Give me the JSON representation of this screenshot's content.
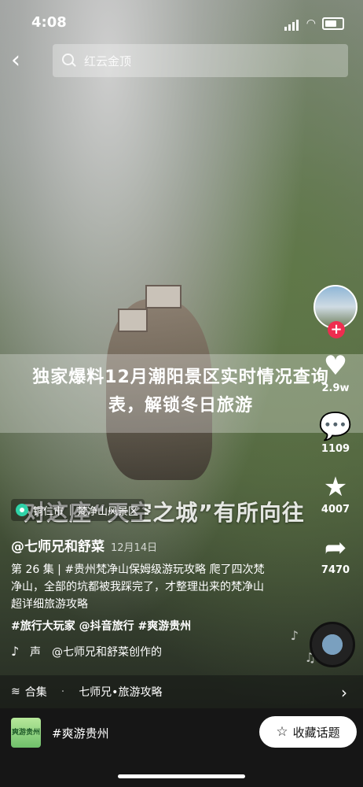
{
  "status": {
    "time": "4:08"
  },
  "search": {
    "query": "红云金顶"
  },
  "banner": {
    "text": "独家爆料12月潮阳景区实时情况查询表，解锁冬日旅游"
  },
  "actions": {
    "likes": "2.9w",
    "comments": "1109",
    "stars": "4007",
    "shares": "7470"
  },
  "location": {
    "city": "铜仁市",
    "spot": "梵净山风景区"
  },
  "overlay": {
    "text": "对这座“天空之城”有所向往"
  },
  "post": {
    "author": "@七师兄和舒菜",
    "date": "12月14日",
    "description": "第 26 集 | #贵州梵净山保姆级游玩攻略 爬了四次梵净山，全部的坑都被我踩完了，才整理出来的梵净山超详细旅游攻略",
    "tags": "#旅行大玩家 @抖音旅行 #爽游贵州",
    "music": "声　@七师兄和舒菜创作的"
  },
  "collection": {
    "label": "合集",
    "name": "七师兄•旅游攻略"
  },
  "topic": {
    "thumb_label": "爽游贵州",
    "name": "#爽游贵州",
    "button": "收藏话题"
  },
  "icons": {
    "back": "back-arrow-icon",
    "search": "search-icon",
    "like": "heart-icon",
    "comment": "comment-icon",
    "star": "star-icon",
    "share": "share-icon",
    "location": "location-pin-icon",
    "music": "tiktok-icon",
    "collection": "layers-icon",
    "chevron": "chevron-right-icon"
  },
  "colors": {
    "accent": "#ee2d4f",
    "location_pin": "#2fd3a8"
  }
}
